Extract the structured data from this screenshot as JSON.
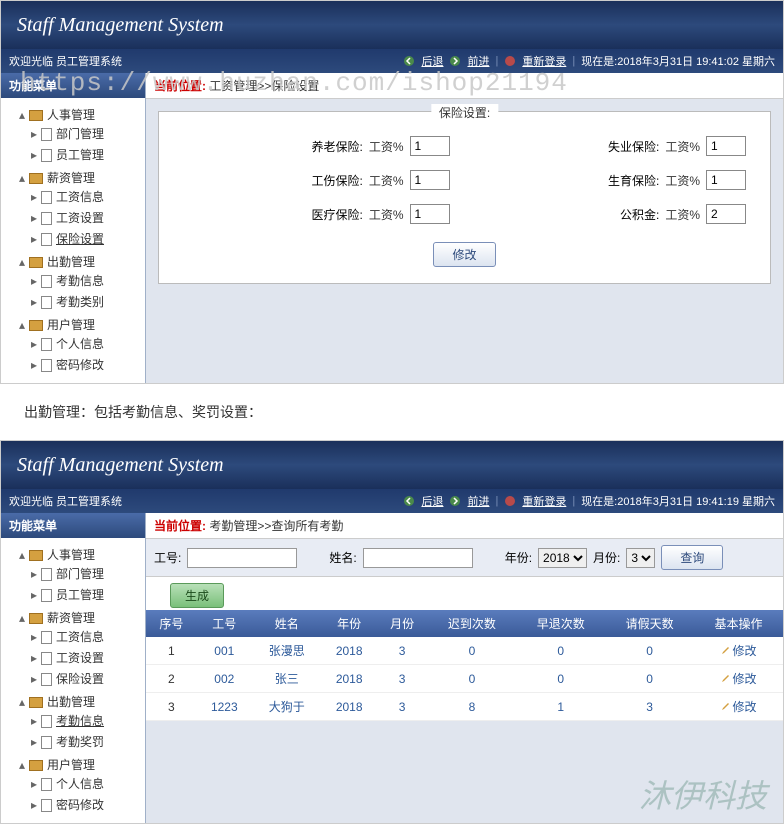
{
  "watermarks": {
    "url": "https://www.huzhan.com/ishop21194",
    "brand": "沐伊科技"
  },
  "caption": "出勤管理：包括考勤信息、奖罚设置：",
  "shell1": {
    "banner": "Staff Management System",
    "topbar": {
      "welcome": "欢迎光临 员工管理系统",
      "back": "后退",
      "forward": "前进",
      "relogin": "重新登录",
      "datetime": "现在是:2018年3月31日 19:41:02 星期六"
    },
    "sidebar": {
      "title": "功能菜单",
      "nodes": [
        {
          "label": "人事管理",
          "children": [
            {
              "label": "部门管理"
            },
            {
              "label": "员工管理"
            }
          ]
        },
        {
          "label": "薪资管理",
          "children": [
            {
              "label": "工资信息"
            },
            {
              "label": "工资设置"
            },
            {
              "label": "保险设置",
              "active": true
            }
          ]
        },
        {
          "label": "出勤管理",
          "children": [
            {
              "label": "考勤信息"
            },
            {
              "label": "考勤类别"
            }
          ]
        },
        {
          "label": "用户管理",
          "children": [
            {
              "label": "个人信息"
            },
            {
              "label": "密码修改"
            }
          ]
        }
      ]
    },
    "breadcrumb": {
      "label": "当前位置:",
      "path": "工资管理>>保险设置"
    },
    "form": {
      "legend": "保险设置:",
      "unit": "工资%",
      "fields": {
        "pension": {
          "label": "养老保险:",
          "value": "1"
        },
        "unemployment": {
          "label": "失业保险:",
          "value": "1"
        },
        "injury": {
          "label": "工伤保险:",
          "value": "1"
        },
        "maternity": {
          "label": "生育保险:",
          "value": "1"
        },
        "medical": {
          "label": "医疗保险:",
          "value": "1"
        },
        "fund": {
          "label": "公积金:",
          "value": "2"
        }
      },
      "submit": "修改"
    }
  },
  "shell2": {
    "banner": "Staff Management System",
    "topbar": {
      "welcome": "欢迎光临 员工管理系统",
      "back": "后退",
      "forward": "前进",
      "relogin": "重新登录",
      "datetime": "现在是:2018年3月31日 19:41:19 星期六"
    },
    "sidebar": {
      "title": "功能菜单",
      "nodes": [
        {
          "label": "人事管理",
          "children": [
            {
              "label": "部门管理"
            },
            {
              "label": "员工管理"
            }
          ]
        },
        {
          "label": "薪资管理",
          "children": [
            {
              "label": "工资信息"
            },
            {
              "label": "工资设置"
            },
            {
              "label": "保险设置"
            }
          ]
        },
        {
          "label": "出勤管理",
          "children": [
            {
              "label": "考勤信息",
              "active": true
            },
            {
              "label": "考勤奖罚"
            }
          ]
        },
        {
          "label": "用户管理",
          "children": [
            {
              "label": "个人信息"
            },
            {
              "label": "密码修改"
            }
          ]
        }
      ]
    },
    "breadcrumb": {
      "label": "当前位置:",
      "path": "考勤管理>>查询所有考勤"
    },
    "search": {
      "empno_label": "工号:",
      "name_label": "姓名:",
      "year_label": "年份:",
      "year_value": "2018",
      "month_label": "月份:",
      "month_value": "3",
      "query_btn": "查询",
      "generate_btn": "生成"
    },
    "table": {
      "headers": [
        "序号",
        "工号",
        "姓名",
        "年份",
        "月份",
        "迟到次数",
        "早退次数",
        "请假天数",
        "基本操作"
      ],
      "op_label": "修改",
      "rows": [
        {
          "seq": "1",
          "empno": "001",
          "name": "张漫思",
          "year": "2018",
          "month": "3",
          "late": "0",
          "early": "0",
          "leave": "0"
        },
        {
          "seq": "2",
          "empno": "002",
          "name": "张三",
          "year": "2018",
          "month": "3",
          "late": "0",
          "early": "0",
          "leave": "0"
        },
        {
          "seq": "3",
          "empno": "1223",
          "name": "大狗于",
          "year": "2018",
          "month": "3",
          "late": "8",
          "early": "1",
          "leave": "3"
        }
      ]
    }
  }
}
